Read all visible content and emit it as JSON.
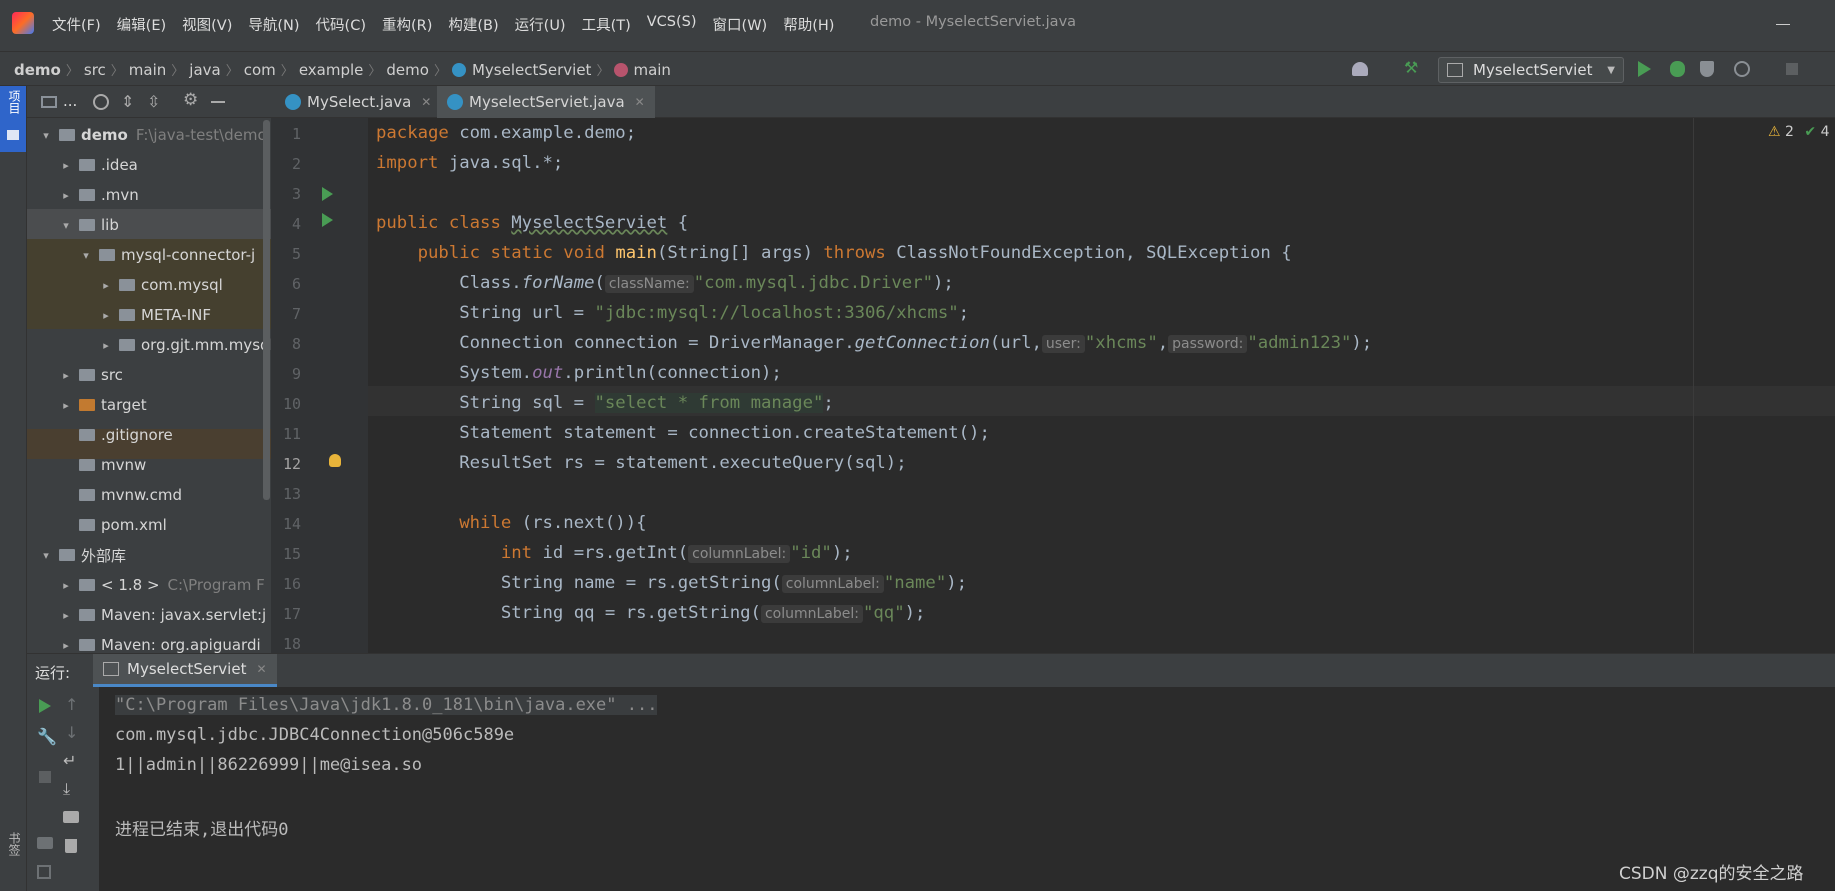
{
  "menu": [
    "文件(F)",
    "编辑(E)",
    "视图(V)",
    "导航(N)",
    "代码(C)",
    "重构(R)",
    "构建(B)",
    "运行(U)",
    "工具(T)",
    "VCS(S)",
    "窗口(W)",
    "帮助(H)"
  ],
  "window_title": "demo - MyselectServiet.java",
  "breadcrumb": [
    "demo",
    "src",
    "main",
    "java",
    "com",
    "example",
    "demo",
    "MyselectServiet",
    "main"
  ],
  "run_config": "MyselectServiet",
  "left_strip_label": "项目",
  "project_panel_title": "...",
  "tree": [
    {
      "label": "demo",
      "hint": "F:\\java-test\\demo",
      "indent": 0,
      "arrow": "▾"
    },
    {
      "label": ".idea",
      "indent": 1,
      "arrow": "▸"
    },
    {
      "label": ".mvn",
      "indent": 1,
      "arrow": "▸"
    },
    {
      "label": "lib",
      "indent": 1,
      "arrow": "▾"
    },
    {
      "label": "mysql-connector-j",
      "indent": 2,
      "arrow": "▾"
    },
    {
      "label": "com.mysql",
      "indent": 3,
      "arrow": "▸"
    },
    {
      "label": "META-INF",
      "indent": 3,
      "arrow": "▸"
    },
    {
      "label": "org.gjt.mm.mysql",
      "indent": 3,
      "arrow": "▸"
    },
    {
      "label": "src",
      "indent": 1,
      "arrow": "▸"
    },
    {
      "label": "target",
      "indent": 1,
      "arrow": "▸"
    },
    {
      "label": ".gitignore",
      "indent": 1,
      "arrow": ""
    },
    {
      "label": "mvnw",
      "indent": 1,
      "arrow": ""
    },
    {
      "label": "mvnw.cmd",
      "indent": 1,
      "arrow": ""
    },
    {
      "label": "pom.xml",
      "indent": 1,
      "arrow": ""
    },
    {
      "label": "外部库",
      "indent": 0,
      "arrow": "▾"
    },
    {
      "label": "< 1.8 >",
      "hint": "C:\\Program F",
      "indent": 1,
      "arrow": "▸"
    },
    {
      "label": "Maven: javax.servlet:j",
      "indent": 1,
      "arrow": "▸"
    },
    {
      "label": "Maven: org.apiguardi",
      "indent": 1,
      "arrow": "▸"
    }
  ],
  "tabs": [
    "MySelect.java",
    "MyselectServiet.java"
  ],
  "inspections": {
    "warnings": "2",
    "checks": "4"
  },
  "code": {
    "l1_kw": "package",
    "l1_rest": " com.example.demo;",
    "l2_kw": "import",
    "l2_rest": " java.sql.*;",
    "l4_kw": "public class",
    "l4_name": "MyselectServiet",
    "l4_rest": " {",
    "l5_kw1": "public static void",
    "l5_fn": "main",
    "l5_mid": "(String[] args) ",
    "l5_kw2": "throws",
    "l5_rest": " ClassNotFoundException, SQLException {",
    "l6_a": "Class.",
    "l6_m": "forName",
    "l6_b": "(",
    "l6_hint": "className:",
    "l6_str": "\"com.mysql.jdbc.Driver\"",
    "l6_c": ");",
    "l7_a": "String url = ",
    "l7_str": "\"jdbc:mysql://localhost:3306/xhcms\"",
    "l7_c": ";",
    "l8_a": "Connection connection = DriverManager.",
    "l8_m": "getConnection",
    "l8_b": "(url,",
    "l8_h1": "user:",
    "l8_s1": "\"xhcms\"",
    "l8_comma": ",",
    "l8_h2": "password:",
    "l8_s2": "\"admin123\"",
    "l8_c": ");",
    "l9_a": "System.",
    "l9_out": "out",
    "l9_b": ".println(connection);",
    "l11_a": "String sql = ",
    "l11_str": "\"select * from manage\"",
    "l11_c": ";",
    "l12": "Statement statement = connection.createStatement();",
    "l13": "ResultSet rs = statement.executeQuery(sql);",
    "l15_kw": "while",
    "l15_rest": " (rs.next()){",
    "l16_kw": "int",
    "l16_a": " id =rs.getInt(",
    "l16_hint": "columnLabel:",
    "l16_str": "\"id\"",
    "l16_c": ");",
    "l17_a": "String name = rs.getString(",
    "l17_hint": "columnLabel:",
    "l17_str": "\"name\"",
    "l17_c": ");",
    "l18_a": "String qq = rs.getString(",
    "l18_hint": "columnLabel:",
    "l18_str": "\"qq\"",
    "l18_c": ");"
  },
  "line_numbers": [
    "1",
    "2",
    "3",
    "4",
    "5",
    "6",
    "7",
    "8",
    "9",
    "10",
    "11",
    "12",
    "13",
    "14",
    "15",
    "16",
    "17",
    "18"
  ],
  "run_panel": {
    "label": "运行:",
    "tab": "MyselectServiet"
  },
  "console": [
    "\"C:\\Program Files\\Java\\jdk1.8.0_181\\bin\\java.exe\" ...",
    "com.mysql.jdbc.JDBC4Connection@506c589e",
    "1||admin||86226999||me@isea.so",
    "",
    "进程已结束,退出代码0"
  ],
  "bookmark_label": "书签",
  "watermark": "CSDN @zzq的安全之路",
  "colors": {
    "accent": "#4a88c7",
    "run_green": "#499c54",
    "keyword": "#cc7832",
    "string": "#6a8759"
  }
}
